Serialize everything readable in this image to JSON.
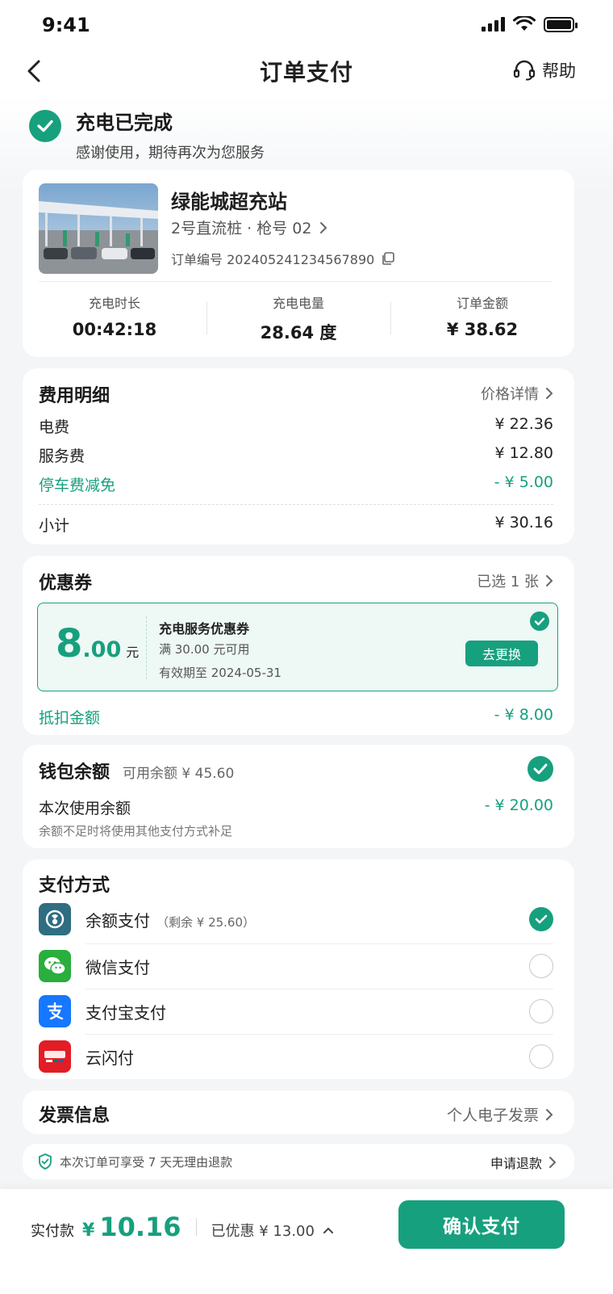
{
  "status_bar": {
    "time": "9:41"
  },
  "nav": {
    "title": "订单支付",
    "help_label": "帮助"
  },
  "completion": {
    "title": "充电已完成",
    "subtitle": "感谢使用，期待再次为您服务"
  },
  "station": {
    "name": "绿能城超充站",
    "pile": "2号直流桩 · 枪号 02",
    "order_no": "订单编号 202405241234567890",
    "stats": [
      {
        "label": "充电时长",
        "value": "00:42:18"
      },
      {
        "label": "充电电量",
        "value": "28.64 度"
      },
      {
        "label": "订单金额",
        "value": "¥ 38.62"
      }
    ]
  },
  "fees": {
    "title": "费用明细",
    "link": "价格详情",
    "items": [
      {
        "label": "电费",
        "value": "¥ 22.36"
      },
      {
        "label": "服务费",
        "value": "¥ 12.80"
      },
      {
        "label": "停车费减免",
        "value": "- ¥ 5.00"
      }
    ],
    "subtotal_label": "小计",
    "subtotal_value": "¥ 30.16"
  },
  "coupon": {
    "title": "优惠券",
    "link": "已选 1 张",
    "amount_int": "8",
    "amount_dec": ".00",
    "unit": "元",
    "name": "充电服务优惠券",
    "condition": "满 30.00 元可用",
    "expiry": "有效期至 2024-05-31",
    "swap_label": "去更换",
    "deduct_label": "抵扣金额",
    "deduct_value": "- ¥ 8.00"
  },
  "wallet": {
    "title": "钱包余额",
    "available": "可用余额 ¥ 45.60",
    "use_label": "本次使用余额",
    "use_value": "- ¥ 20.00",
    "note": "余额不足时将使用其他支付方式补足"
  },
  "payment": {
    "title": "支付方式",
    "methods": [
      {
        "label": "余额支付",
        "note": "（剩余 ¥ 25.60）",
        "icon": "wallet-icon",
        "selected": true
      },
      {
        "label": "微信支付",
        "note": "",
        "icon": "wechat-icon",
        "selected": false
      },
      {
        "label": "支付宝支付",
        "note": "",
        "icon": "alipay-icon",
        "selected": false
      },
      {
        "label": "云闪付",
        "note": "",
        "icon": "unionpay-icon",
        "selected": false
      }
    ]
  },
  "invoice": {
    "title": "发票信息",
    "value": "个人电子发票"
  },
  "refund": {
    "text": "本次订单可享受 7 天无理由退款",
    "link": "申请退款"
  },
  "bottom": {
    "pay_label": "实付款",
    "currency": "¥",
    "pay_value": "10.16",
    "saved": "已优惠 ¥ 13.00",
    "confirm": "确认支付"
  },
  "colors": {
    "accent": "#17a07e",
    "background": "#f3f5f7"
  }
}
